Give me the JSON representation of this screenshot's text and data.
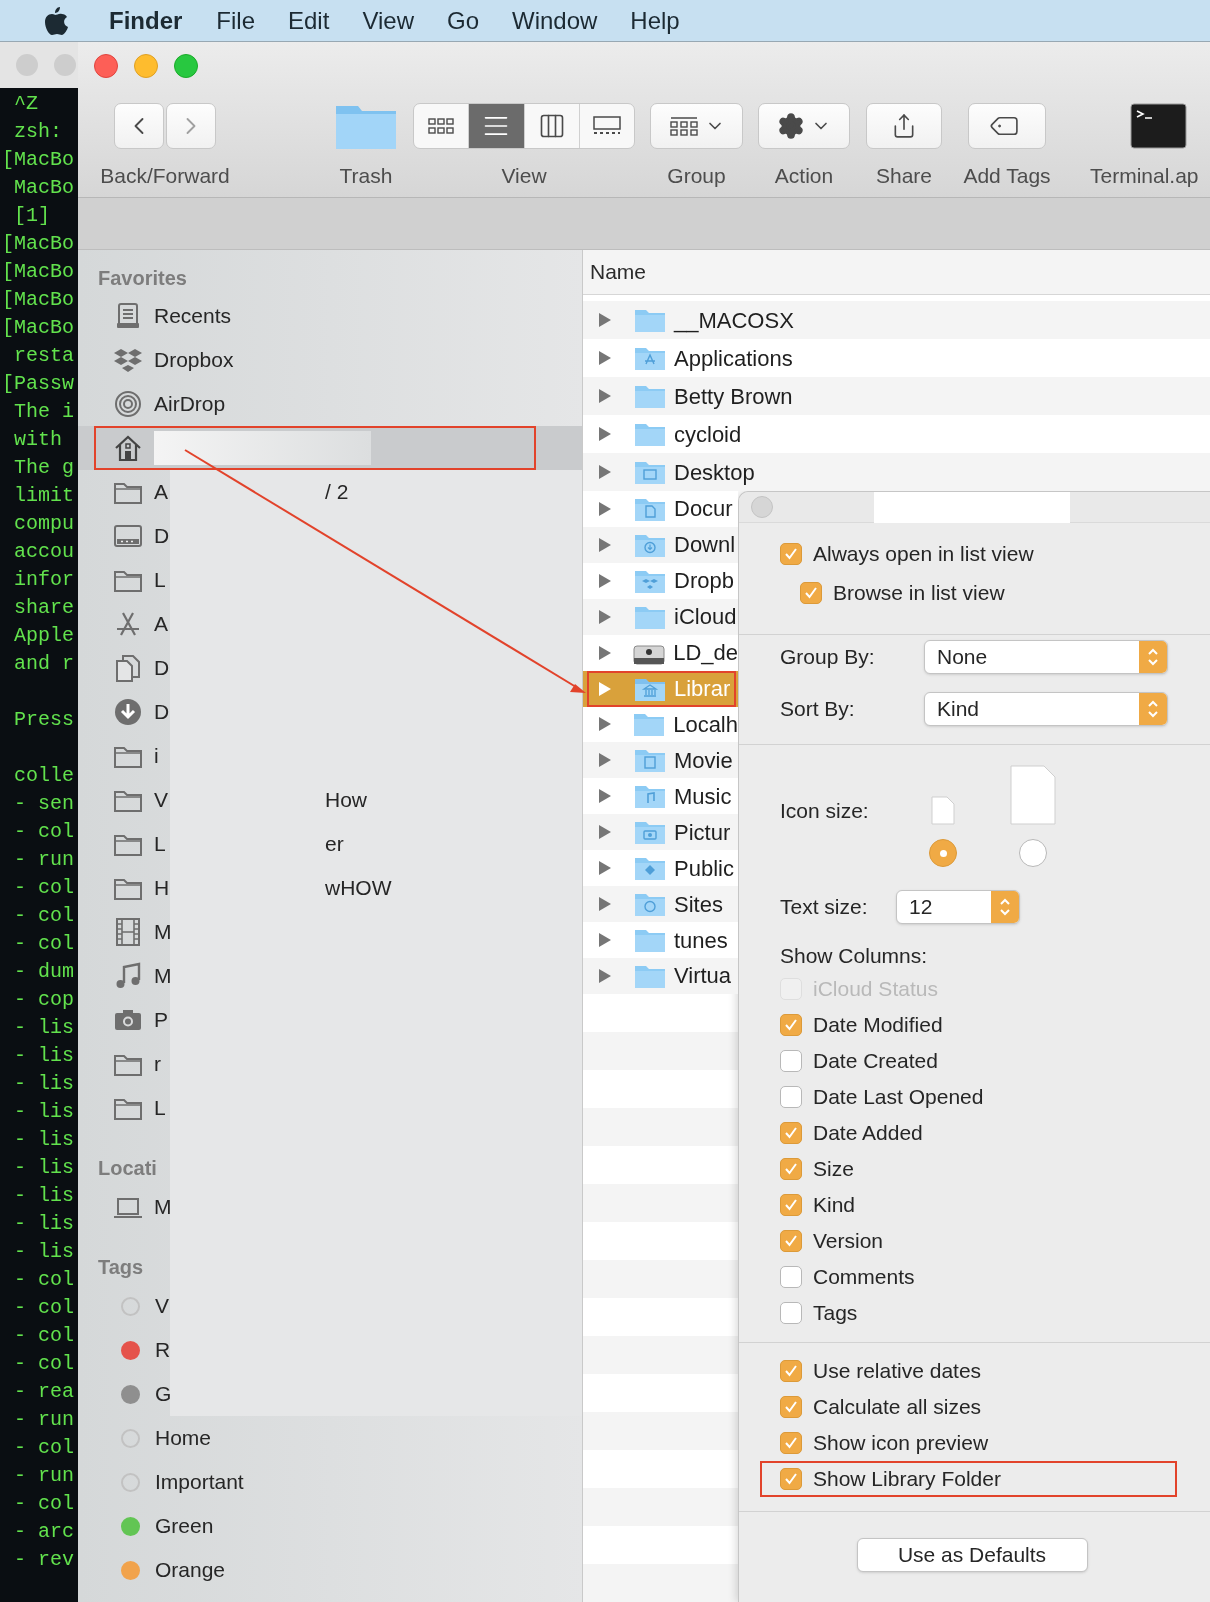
{
  "menu_bar": {
    "app": "Finder",
    "items": [
      "File",
      "Edit",
      "View",
      "Go",
      "Window",
      "Help"
    ]
  },
  "terminal": {
    "blocks": [
      [
        " ^Z",
        " zsh:",
        "[MacBo",
        " MacBo",
        " [1]",
        "[MacBo",
        "[MacBo",
        "[MacBo",
        "[MacBo",
        " resta",
        "[Passw",
        " The i",
        " with",
        " The g",
        " limit",
        " compu",
        " accou",
        " infor",
        " share",
        " Apple",
        " and r"
      ],
      [
        " Press"
      ],
      [
        " colle",
        " - sen",
        " - col",
        " - run",
        " - col",
        " - col",
        " - col",
        " - dum",
        " - cop",
        " - lis",
        " - lis",
        " - lis",
        " - lis",
        " - lis",
        " - lis",
        " - lis",
        " - lis",
        " - lis",
        " - col",
        " - col",
        " - col",
        " - col",
        " - rea",
        " - run",
        " - col",
        " - run",
        " - col",
        " - arc",
        " - rev"
      ]
    ]
  },
  "toolbar": {
    "items": [
      {
        "kind": "back_forward",
        "label": "Back/Forward"
      },
      {
        "kind": "trash",
        "label": "Trash"
      },
      {
        "kind": "view",
        "label": "View",
        "modes": [
          {
            "kind": "icons",
            "selected": false
          },
          {
            "kind": "list",
            "selected": true
          },
          {
            "kind": "columns",
            "selected": false
          },
          {
            "kind": "gallery",
            "selected": false
          }
        ]
      },
      {
        "kind": "group",
        "label": "Group"
      },
      {
        "kind": "action",
        "label": "Action"
      },
      {
        "kind": "share",
        "label": "Share"
      },
      {
        "kind": "tags",
        "label": "Add Tags"
      },
      {
        "kind": "app",
        "label": "Terminal.ap"
      }
    ]
  },
  "sidebar": {
    "favorites_header": "Favorites",
    "favorites": [
      {
        "kind": "recents",
        "label": "Recents",
        "selected": false,
        "annotated": false,
        "covered": false
      },
      {
        "kind": "dropbox",
        "label": "Dropbox",
        "selected": false,
        "annotated": false,
        "covered": false
      },
      {
        "kind": "airdrop",
        "label": "AirDrop",
        "selected": false,
        "annotated": false,
        "covered": false
      },
      {
        "kind": "home",
        "selected": true,
        "annotated": true,
        "covered": false
      },
      {
        "kind": "folder",
        "label": "A",
        "fragment": "/ 2",
        "selected": false,
        "annotated": false,
        "covered": true
      },
      {
        "kind": "display",
        "label": "D",
        "selected": false,
        "annotated": false,
        "covered": true
      },
      {
        "kind": "folder",
        "label": "L",
        "selected": false,
        "annotated": false,
        "covered": true
      },
      {
        "kind": "apps",
        "label": "A",
        "selected": false,
        "annotated": false,
        "covered": true
      },
      {
        "kind": "documents",
        "label": "D",
        "selected": false,
        "annotated": false,
        "covered": true
      },
      {
        "kind": "downloads",
        "label": "D",
        "selected": false,
        "annotated": false,
        "covered": true
      },
      {
        "kind": "folder",
        "label": "i",
        "selected": false,
        "annotated": false,
        "covered": true
      },
      {
        "kind": "folder",
        "label": "V",
        "fragment": "How",
        "selected": false,
        "annotated": false,
        "covered": true
      },
      {
        "kind": "folder",
        "label": "L",
        "fragment": "er",
        "selected": false,
        "annotated": false,
        "covered": true
      },
      {
        "kind": "folder",
        "label": "H",
        "fragment": "wHOW",
        "selected": false,
        "annotated": false,
        "covered": true
      },
      {
        "kind": "movies",
        "label": "M",
        "selected": false,
        "annotated": false,
        "covered": true
      },
      {
        "kind": "music",
        "label": "M",
        "selected": false,
        "annotated": false,
        "covered": true
      },
      {
        "kind": "pictures",
        "label": "P",
        "selected": false,
        "annotated": false,
        "covered": true
      },
      {
        "kind": "folder",
        "label": "r",
        "selected": false,
        "annotated": false,
        "covered": true
      },
      {
        "kind": "folder",
        "label": "L",
        "selected": false,
        "annotated": false,
        "covered": true
      }
    ],
    "locations_header": "Locati",
    "locations": [
      {
        "kind": "laptop",
        "label": "M"
      }
    ],
    "tags_header": "Tags",
    "tags": [
      {
        "label": "V",
        "color": "#c2c2c2",
        "kind": "outline",
        "covered": true
      },
      {
        "label": "R",
        "color": "#e5534b",
        "kind": "solid",
        "covered": true
      },
      {
        "label": "G",
        "color": "#8f8f8f",
        "kind": "solid",
        "covered": true
      },
      {
        "label": "Home",
        "color": "#c2c2c2",
        "kind": "outline",
        "covered": false
      },
      {
        "label": "Important",
        "color": "#c2c2c2",
        "kind": "outline",
        "covered": false
      },
      {
        "label": "Green",
        "color": "#62c554",
        "kind": "solid",
        "covered": false
      },
      {
        "label": "Orange",
        "color": "#f1a34c",
        "kind": "solid",
        "covered": false
      }
    ]
  },
  "file_list": {
    "column": "Name",
    "rows": [
      {
        "kind": "folder",
        "name": "__MACOSX",
        "selected": false,
        "annotated": false,
        "covered": false
      },
      {
        "kind": "applications",
        "name": "Applications",
        "selected": false,
        "annotated": false,
        "covered": false
      },
      {
        "kind": "folder",
        "name": "Betty Brown",
        "selected": false,
        "annotated": false,
        "covered": false
      },
      {
        "kind": "folder",
        "name": "cycloid",
        "selected": false,
        "annotated": false,
        "covered": false
      },
      {
        "kind": "desktop",
        "name": "Desktop",
        "selected": false,
        "annotated": false,
        "covered": false
      },
      {
        "kind": "documents",
        "name": "Docur",
        "selected": false,
        "annotated": false,
        "covered": true
      },
      {
        "kind": "downloads",
        "name": "Downl",
        "selected": false,
        "annotated": false,
        "covered": true
      },
      {
        "kind": "dropbox",
        "name": "Dropb",
        "selected": false,
        "annotated": false,
        "covered": true
      },
      {
        "kind": "folder",
        "name": "iCloud",
        "selected": false,
        "annotated": false,
        "covered": true
      },
      {
        "kind": "drive",
        "name": "LD_de",
        "selected": false,
        "annotated": false,
        "covered": true
      },
      {
        "kind": "library",
        "name": "Librar",
        "selected": true,
        "annotated": true,
        "covered": true
      },
      {
        "kind": "folder",
        "name": "Localh",
        "selected": false,
        "annotated": false,
        "covered": true
      },
      {
        "kind": "movies",
        "name": "Movie",
        "selected": false,
        "annotated": false,
        "covered": true
      },
      {
        "kind": "music",
        "name": "Music",
        "selected": false,
        "annotated": false,
        "covered": true
      },
      {
        "kind": "pictures",
        "name": "Pictur",
        "selected": false,
        "annotated": false,
        "covered": true
      },
      {
        "kind": "public",
        "name": "Public",
        "selected": false,
        "annotated": false,
        "covered": true
      },
      {
        "kind": "sites",
        "name": "Sites",
        "selected": false,
        "annotated": false,
        "covered": true
      },
      {
        "kind": "folder",
        "name": "tunes",
        "selected": false,
        "annotated": false,
        "covered": true
      },
      {
        "kind": "folder",
        "name": "Virtua",
        "selected": false,
        "annotated": false,
        "covered": true
      }
    ]
  },
  "view_options": {
    "open_options": [
      {
        "label": "Always open in list view",
        "checked": true,
        "kind": "top"
      },
      {
        "label": "Browse in list view",
        "checked": true,
        "kind": "nested"
      }
    ],
    "group_by": {
      "label": "Group By:",
      "value": "None"
    },
    "sort_by": {
      "label": "Sort By:",
      "value": "Kind"
    },
    "icon_size": {
      "label": "Icon size:",
      "options": [
        {
          "kind": "small",
          "selected": true
        },
        {
          "kind": "large",
          "selected": false
        }
      ]
    },
    "text_size": {
      "label": "Text size:",
      "value": "12"
    },
    "show_columns": {
      "label": "Show Columns:",
      "columns": [
        {
          "label": "iCloud Status",
          "checked": false,
          "disabled": true
        },
        {
          "label": "Date Modified",
          "checked": true,
          "disabled": false
        },
        {
          "label": "Date Created",
          "checked": false,
          "disabled": false
        },
        {
          "label": "Date Last Opened",
          "checked": false,
          "disabled": false
        },
        {
          "label": "Date Added",
          "checked": true,
          "disabled": false
        },
        {
          "label": "Size",
          "checked": true,
          "disabled": false
        },
        {
          "label": "Kind",
          "checked": true,
          "disabled": false
        },
        {
          "label": "Version",
          "checked": true,
          "disabled": false
        },
        {
          "label": "Comments",
          "checked": false,
          "disabled": false
        },
        {
          "label": "Tags",
          "checked": false,
          "disabled": false
        }
      ]
    },
    "more_options": [
      {
        "label": "Use relative dates",
        "checked": true,
        "annotated": false
      },
      {
        "label": "Calculate all sizes",
        "checked": true,
        "annotated": false
      },
      {
        "label": "Show icon preview",
        "checked": true,
        "annotated": false
      },
      {
        "label": "Show Library Folder",
        "checked": true,
        "annotated": true
      }
    ],
    "defaults_button": "Use as Defaults"
  }
}
